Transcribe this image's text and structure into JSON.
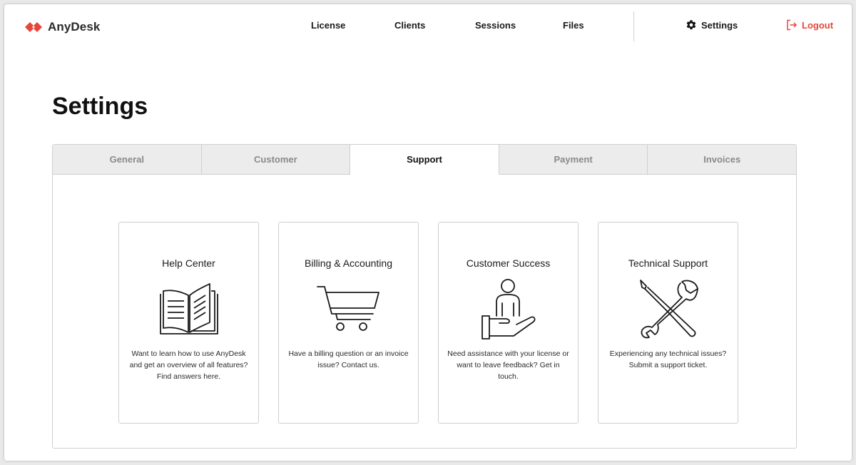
{
  "app": {
    "logo_text": "AnyDesk",
    "brand_color": "#e5463a"
  },
  "nav": {
    "links": [
      {
        "label": "License"
      },
      {
        "label": "Clients"
      },
      {
        "label": "Sessions"
      },
      {
        "label": "Files"
      }
    ],
    "settings_label": "Settings",
    "settings_icon": "gear-icon",
    "logout_label": "Logout",
    "logout_icon": "logout-icon"
  },
  "page": {
    "title": "Settings"
  },
  "tabs": [
    {
      "label": "General",
      "active": false
    },
    {
      "label": "Customer",
      "active": false
    },
    {
      "label": "Support",
      "active": true
    },
    {
      "label": "Payment",
      "active": false
    },
    {
      "label": "Invoices",
      "active": false
    }
  ],
  "support_cards": [
    {
      "title": "Help Center",
      "icon": "book-icon",
      "description": "Want to learn how to use AnyDesk and get an overview of all features? Find answers here."
    },
    {
      "title": "Billing & Accounting",
      "icon": "shopping-cart-icon",
      "description": "Have a billing question or an invoice issue? Contact us."
    },
    {
      "title": "Customer Success",
      "icon": "person-hand-icon",
      "description": "Need assistance with your license or want to leave feedback? Get in touch."
    },
    {
      "title": "Technical Support",
      "icon": "tools-icon",
      "description": "Experiencing any technical issues? Submit a support ticket."
    }
  ]
}
